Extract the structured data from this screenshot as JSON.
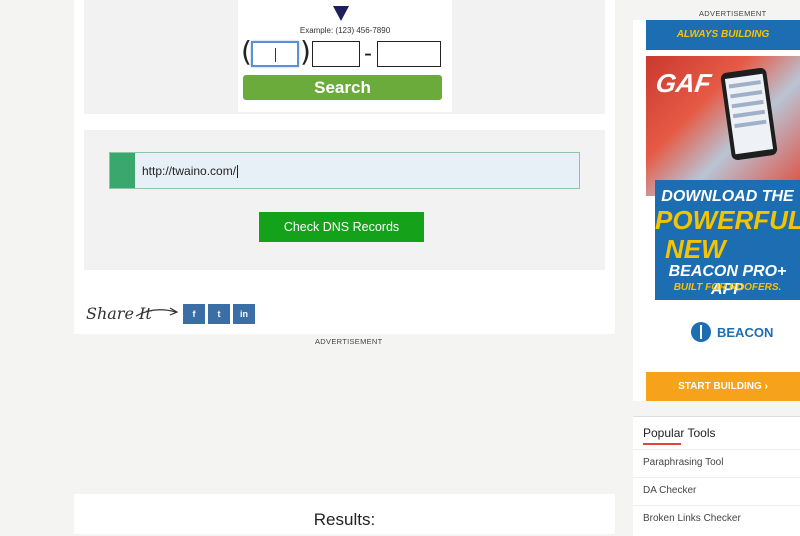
{
  "phone_widget": {
    "example": "Example: (123) 456-7890",
    "open_paren": "(",
    "close_paren": ")",
    "dash": "-",
    "search_label": "Search"
  },
  "dns_form": {
    "url_value": "http://twaino.com/",
    "check_label": "Check DNS Records"
  },
  "share": {
    "label": "Share It",
    "facebook": "f",
    "twitter": "t",
    "linkedin": "in"
  },
  "ads": {
    "label_right": "ADVERTISEMENT",
    "label_main": "ADVERTISEMENT",
    "tagline": "ALWAYS BUILDING",
    "brand": "GAF",
    "line1": "DOWNLOAD THE",
    "line2": "POWERFUL,",
    "line3": "NEW",
    "line4": "BEACON PRO+ APP",
    "line5": "BUILT FOR ROOFERS.",
    "logo": "BEACON",
    "cta": "START BUILDING ›"
  },
  "results": {
    "title": "Results:"
  },
  "popular_tools": {
    "title": "Popular Tools",
    "items": [
      "Paraphrasing Tool",
      "DA Checker",
      "Broken Links Checker"
    ]
  },
  "colors": {
    "search_green": "#6aab3c",
    "check_green": "#14a21a",
    "social_blue": "#3a6ea5",
    "ad_blue": "#1d6db3",
    "ad_yellow": "#f4c400",
    "ad_orange": "#f7a21b"
  }
}
